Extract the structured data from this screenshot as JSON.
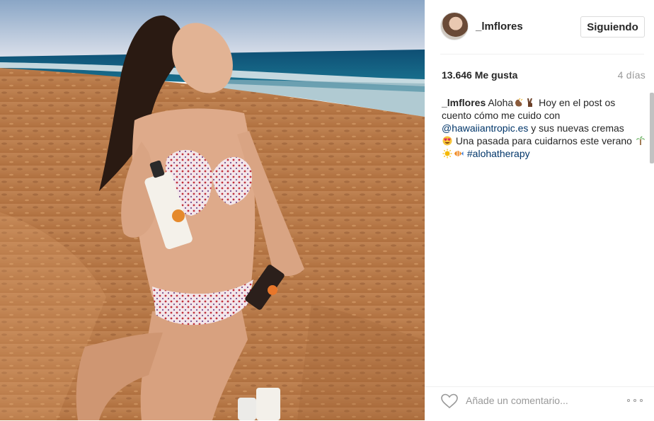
{
  "post": {
    "author": {
      "username": "_lmflores",
      "follow_label": "Siguiendo",
      "avatar_icon": "avatar-photo"
    },
    "stats": {
      "likes_label": "13.646 Me gusta",
      "time_ago": "4 días"
    },
    "caption": {
      "username": "_lmflores",
      "text1": "Aloha",
      "text2": " Hoy en el post os cuento cómo me cuido con ",
      "mention": "@hawaiiantropic.es",
      "text3": " y sus nuevas cremas ",
      "text4": " Una pasada para cuidarnos este verano ",
      "hashtag": "#alohatherapy",
      "emojis": [
        "clapping-hands-emoji",
        "victory-hand-emoji",
        "heart-eyes-emoji",
        "palm-tree-emoji",
        "sun-emoji",
        "tropical-fish-emoji"
      ]
    },
    "comment": {
      "placeholder": "Añade un comentario...",
      "like_icon": "heart-outline-icon",
      "more_icon": "more-options-icon"
    },
    "colors": {
      "link": "#003569",
      "muted": "#999999",
      "text": "#262626",
      "border": "#dbdbdb"
    }
  }
}
